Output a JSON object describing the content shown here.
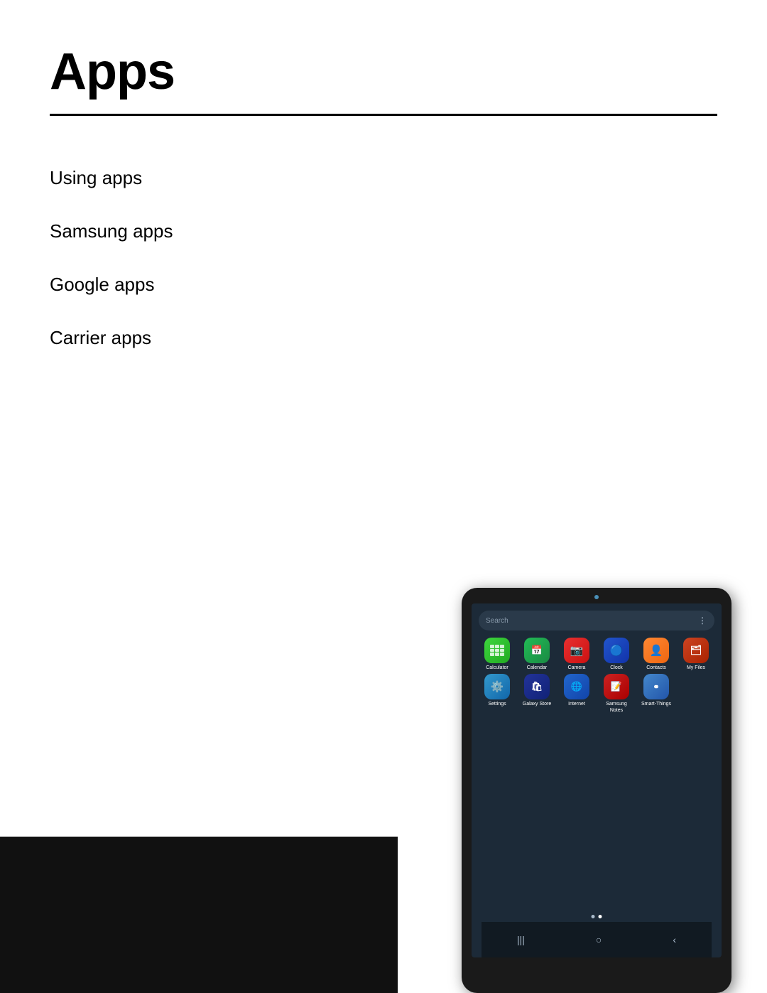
{
  "page": {
    "title": "Apps",
    "divider": true,
    "nav_items": [
      {
        "id": "using-apps",
        "label": "Using apps"
      },
      {
        "id": "samsung-apps",
        "label": "Samsung apps"
      },
      {
        "id": "google-apps",
        "label": "Google apps"
      },
      {
        "id": "carrier-apps",
        "label": "Carrier apps"
      }
    ]
  },
  "tablet": {
    "search_placeholder": "Search",
    "apps_row1": [
      {
        "id": "calculator",
        "label": "Calculator",
        "icon_class": "icon-calculator"
      },
      {
        "id": "calendar",
        "label": "Calendar",
        "icon_class": "icon-calendar"
      },
      {
        "id": "camera",
        "label": "Camera",
        "icon_class": "icon-camera"
      },
      {
        "id": "clock",
        "label": "Clock",
        "icon_class": "icon-clock"
      },
      {
        "id": "contacts",
        "label": "Contacts",
        "icon_class": "icon-contacts"
      },
      {
        "id": "myfiles",
        "label": "My Files",
        "icon_class": "icon-myfiles"
      }
    ],
    "apps_row2": [
      {
        "id": "settings",
        "label": "Settings",
        "icon_class": "icon-settings"
      },
      {
        "id": "galaxystore",
        "label": "Galaxy Store",
        "icon_class": "icon-galaxystore"
      },
      {
        "id": "internet",
        "label": "Internet",
        "icon_class": "icon-internet"
      },
      {
        "id": "samsungnotes",
        "label": "Samsung Notes",
        "icon_class": "icon-samsungnotes"
      },
      {
        "id": "smartthings",
        "label": "Smart-Things",
        "icon_class": "icon-smartthings"
      }
    ],
    "nav_icons": [
      "|||",
      "○",
      "‹"
    ],
    "page_dots": [
      false,
      true
    ]
  }
}
